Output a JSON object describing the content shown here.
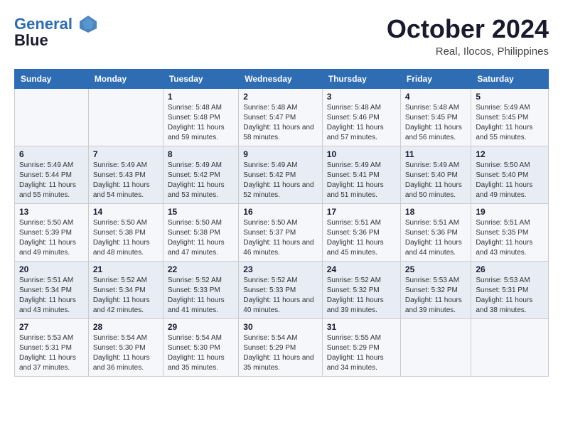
{
  "header": {
    "logo_line1": "General",
    "logo_line2": "Blue",
    "month": "October 2024",
    "location": "Real, Ilocos, Philippines"
  },
  "days_of_week": [
    "Sunday",
    "Monday",
    "Tuesday",
    "Wednesday",
    "Thursday",
    "Friday",
    "Saturday"
  ],
  "weeks": [
    [
      {
        "num": "",
        "info": ""
      },
      {
        "num": "",
        "info": ""
      },
      {
        "num": "1",
        "info": "Sunrise: 5:48 AM\nSunset: 5:48 PM\nDaylight: 11 hours and 59 minutes."
      },
      {
        "num": "2",
        "info": "Sunrise: 5:48 AM\nSunset: 5:47 PM\nDaylight: 11 hours and 58 minutes."
      },
      {
        "num": "3",
        "info": "Sunrise: 5:48 AM\nSunset: 5:46 PM\nDaylight: 11 hours and 57 minutes."
      },
      {
        "num": "4",
        "info": "Sunrise: 5:48 AM\nSunset: 5:45 PM\nDaylight: 11 hours and 56 minutes."
      },
      {
        "num": "5",
        "info": "Sunrise: 5:49 AM\nSunset: 5:45 PM\nDaylight: 11 hours and 55 minutes."
      }
    ],
    [
      {
        "num": "6",
        "info": "Sunrise: 5:49 AM\nSunset: 5:44 PM\nDaylight: 11 hours and 55 minutes."
      },
      {
        "num": "7",
        "info": "Sunrise: 5:49 AM\nSunset: 5:43 PM\nDaylight: 11 hours and 54 minutes."
      },
      {
        "num": "8",
        "info": "Sunrise: 5:49 AM\nSunset: 5:42 PM\nDaylight: 11 hours and 53 minutes."
      },
      {
        "num": "9",
        "info": "Sunrise: 5:49 AM\nSunset: 5:42 PM\nDaylight: 11 hours and 52 minutes."
      },
      {
        "num": "10",
        "info": "Sunrise: 5:49 AM\nSunset: 5:41 PM\nDaylight: 11 hours and 51 minutes."
      },
      {
        "num": "11",
        "info": "Sunrise: 5:49 AM\nSunset: 5:40 PM\nDaylight: 11 hours and 50 minutes."
      },
      {
        "num": "12",
        "info": "Sunrise: 5:50 AM\nSunset: 5:40 PM\nDaylight: 11 hours and 49 minutes."
      }
    ],
    [
      {
        "num": "13",
        "info": "Sunrise: 5:50 AM\nSunset: 5:39 PM\nDaylight: 11 hours and 49 minutes."
      },
      {
        "num": "14",
        "info": "Sunrise: 5:50 AM\nSunset: 5:38 PM\nDaylight: 11 hours and 48 minutes."
      },
      {
        "num": "15",
        "info": "Sunrise: 5:50 AM\nSunset: 5:38 PM\nDaylight: 11 hours and 47 minutes."
      },
      {
        "num": "16",
        "info": "Sunrise: 5:50 AM\nSunset: 5:37 PM\nDaylight: 11 hours and 46 minutes."
      },
      {
        "num": "17",
        "info": "Sunrise: 5:51 AM\nSunset: 5:36 PM\nDaylight: 11 hours and 45 minutes."
      },
      {
        "num": "18",
        "info": "Sunrise: 5:51 AM\nSunset: 5:36 PM\nDaylight: 11 hours and 44 minutes."
      },
      {
        "num": "19",
        "info": "Sunrise: 5:51 AM\nSunset: 5:35 PM\nDaylight: 11 hours and 43 minutes."
      }
    ],
    [
      {
        "num": "20",
        "info": "Sunrise: 5:51 AM\nSunset: 5:34 PM\nDaylight: 11 hours and 43 minutes."
      },
      {
        "num": "21",
        "info": "Sunrise: 5:52 AM\nSunset: 5:34 PM\nDaylight: 11 hours and 42 minutes."
      },
      {
        "num": "22",
        "info": "Sunrise: 5:52 AM\nSunset: 5:33 PM\nDaylight: 11 hours and 41 minutes."
      },
      {
        "num": "23",
        "info": "Sunrise: 5:52 AM\nSunset: 5:33 PM\nDaylight: 11 hours and 40 minutes."
      },
      {
        "num": "24",
        "info": "Sunrise: 5:52 AM\nSunset: 5:32 PM\nDaylight: 11 hours and 39 minutes."
      },
      {
        "num": "25",
        "info": "Sunrise: 5:53 AM\nSunset: 5:32 PM\nDaylight: 11 hours and 39 minutes."
      },
      {
        "num": "26",
        "info": "Sunrise: 5:53 AM\nSunset: 5:31 PM\nDaylight: 11 hours and 38 minutes."
      }
    ],
    [
      {
        "num": "27",
        "info": "Sunrise: 5:53 AM\nSunset: 5:31 PM\nDaylight: 11 hours and 37 minutes."
      },
      {
        "num": "28",
        "info": "Sunrise: 5:54 AM\nSunset: 5:30 PM\nDaylight: 11 hours and 36 minutes."
      },
      {
        "num": "29",
        "info": "Sunrise: 5:54 AM\nSunset: 5:30 PM\nDaylight: 11 hours and 35 minutes."
      },
      {
        "num": "30",
        "info": "Sunrise: 5:54 AM\nSunset: 5:29 PM\nDaylight: 11 hours and 35 minutes."
      },
      {
        "num": "31",
        "info": "Sunrise: 5:55 AM\nSunset: 5:29 PM\nDaylight: 11 hours and 34 minutes."
      },
      {
        "num": "",
        "info": ""
      },
      {
        "num": "",
        "info": ""
      }
    ]
  ]
}
